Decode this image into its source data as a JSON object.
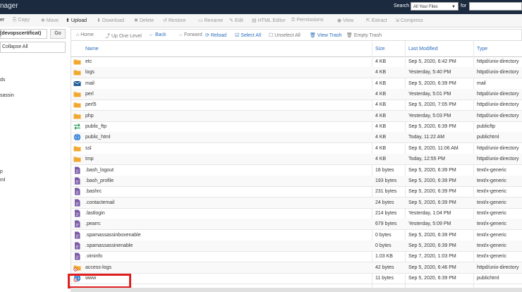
{
  "header": {
    "app_title": "nager",
    "search_label": "Search",
    "search_scope": "All Your Files",
    "for_label": "for",
    "search_value": ""
  },
  "toolbar": {
    "items": [
      {
        "label": "er",
        "icon": "",
        "active": true
      },
      {
        "label": "Copy",
        "icon": "copy-icon",
        "active": false
      },
      {
        "label": "Move",
        "icon": "move-icon",
        "active": false
      },
      {
        "label": "Upload",
        "icon": "upload-icon",
        "active": true
      },
      {
        "label": "Download",
        "icon": "download-icon",
        "active": false
      },
      {
        "label": "Delete",
        "icon": "delete-icon",
        "active": false
      },
      {
        "label": "Restore",
        "icon": "restore-icon",
        "active": false
      },
      {
        "label": "Rename",
        "icon": "rename-icon",
        "active": false
      },
      {
        "label": "Edit",
        "icon": "edit-icon",
        "active": false
      },
      {
        "label": "HTML Editor",
        "icon": "html-editor-icon",
        "active": false
      },
      {
        "label": "Permissions",
        "icon": "key-icon",
        "active": false
      },
      {
        "label": "View",
        "icon": "eye-icon",
        "active": false
      },
      {
        "label": "Extract",
        "icon": "extract-icon",
        "active": false
      },
      {
        "label": "Compress",
        "icon": "compress-icon",
        "active": false
      }
    ]
  },
  "sidebar": {
    "path_value": "",
    "go_label": "Go",
    "collapse_label": "Collapse All",
    "tree": [
      {
        "label": "(devopscertificat)",
        "bold": true
      },
      {
        "label": "ds",
        "bold": false
      },
      {
        "label": "sassin",
        "bold": false
      },
      {
        "label": "p",
        "bold": false
      },
      {
        "label": "ml",
        "bold": false
      }
    ]
  },
  "navbar": {
    "items": [
      {
        "label": "Home",
        "icon": "home-icon",
        "style": "gray"
      },
      {
        "label": "Up One Level",
        "icon": "up-level-icon",
        "style": "gray"
      },
      {
        "label": "Back",
        "icon": "back-arrow-icon",
        "style": "blue"
      },
      {
        "label": "Forward",
        "icon": "forward-arrow-icon",
        "style": "gray"
      },
      {
        "label": "Reload",
        "icon": "reload-icon",
        "style": "blue"
      },
      {
        "label": "Select All",
        "icon": "select-all-icon",
        "style": "blue"
      },
      {
        "label": "Unselect All",
        "icon": "unselect-all-icon",
        "style": "gray"
      },
      {
        "label": "View Trash",
        "icon": "trash-icon",
        "style": "blue"
      },
      {
        "label": "Empty Trash",
        "icon": "empty-trash-icon",
        "style": "gray"
      }
    ]
  },
  "table": {
    "headers": {
      "name": "Name",
      "size": "Size",
      "modified": "Last Modified",
      "type": "Type"
    },
    "rows": [
      {
        "name": "etc",
        "size": "4 KB",
        "modified": "Sep 5, 2020, 6:42 PM",
        "type": "httpd/unix-directory",
        "icon": "folder"
      },
      {
        "name": "logs",
        "size": "4 KB",
        "modified": "Yesterday, 5:40 PM",
        "type": "httpd/unix-directory",
        "icon": "folder"
      },
      {
        "name": "mail",
        "size": "4 KB",
        "modified": "Sep 5, 2020, 6:39 PM",
        "type": "mail",
        "icon": "mail"
      },
      {
        "name": "perl",
        "size": "4 KB",
        "modified": "Yesterday, 5:01 PM",
        "type": "httpd/unix-directory",
        "icon": "folder"
      },
      {
        "name": "perl5",
        "size": "4 KB",
        "modified": "Sep 5, 2020, 7:05 PM",
        "type": "httpd/unix-directory",
        "icon": "folder"
      },
      {
        "name": "php",
        "size": "4 KB",
        "modified": "Yesterday, 5:03 PM",
        "type": "httpd/unix-directory",
        "icon": "folder"
      },
      {
        "name": "public_ftp",
        "size": "4 KB",
        "modified": "Sep 5, 2020, 6:39 PM",
        "type": "publicftp",
        "icon": "ftp"
      },
      {
        "name": "public_html",
        "size": "4 KB",
        "modified": "Today, 11:22 AM",
        "type": "publichtml",
        "icon": "globe"
      },
      {
        "name": "ssl",
        "size": "4 KB",
        "modified": "Sep 6, 2020, 11:06 AM",
        "type": "httpd/unix-directory",
        "icon": "folder"
      },
      {
        "name": "tmp",
        "size": "4 KB",
        "modified": "Today, 12:55 PM",
        "type": "httpd/unix-directory",
        "icon": "folder"
      },
      {
        "name": ".bash_logout",
        "size": "18 bytes",
        "modified": "Sep 5, 2020, 6:39 PM",
        "type": "text/x-generic",
        "icon": "file"
      },
      {
        "name": ".bash_profile",
        "size": "193 bytes",
        "modified": "Sep 5, 2020, 6:39 PM",
        "type": "text/x-generic",
        "icon": "file"
      },
      {
        "name": ".bashrc",
        "size": "231 bytes",
        "modified": "Sep 5, 2020, 6:39 PM",
        "type": "text/x-generic",
        "icon": "file"
      },
      {
        "name": ".contactemail",
        "size": "24 bytes",
        "modified": "Sep 5, 2020, 6:39 PM",
        "type": "text/x-generic",
        "icon": "file"
      },
      {
        "name": ".lastlogin",
        "size": "214 bytes",
        "modified": "Yesterday, 1:04 PM",
        "type": "text/x-generic",
        "icon": "file"
      },
      {
        "name": ".pearrc",
        "size": "679 bytes",
        "modified": "Yesterday, 5:09 PM",
        "type": "text/x-generic",
        "icon": "file"
      },
      {
        "name": ".spamassassinboxenable",
        "size": "0 bytes",
        "modified": "Sep 5, 2020, 6:39 PM",
        "type": "text/x-generic",
        "icon": "file"
      },
      {
        "name": ".spamassassinenable",
        "size": "0 bytes",
        "modified": "Sep 5, 2020, 6:39 PM",
        "type": "text/x-generic",
        "icon": "file"
      },
      {
        "name": ".viminfo",
        "size": "1.03 KB",
        "modified": "Sep 7, 2020, 1:03 PM",
        "type": "text/x-generic",
        "icon": "file"
      },
      {
        "name": "access-logs",
        "size": "42 bytes",
        "modified": "Sep 5, 2020, 6:46 PM",
        "type": "httpd/unix-directory",
        "icon": "folder-link"
      },
      {
        "name": "www",
        "size": "11 bytes",
        "modified": "Sep 5, 2020, 6:39 PM",
        "type": "publichtml",
        "icon": "globe-link"
      }
    ]
  },
  "colors": {
    "header_bg": "#1b2a3f",
    "link_blue": "#2a6ebb",
    "folder": "#f0a830",
    "file": "#7a5aa8",
    "highlight": "#e02020"
  }
}
